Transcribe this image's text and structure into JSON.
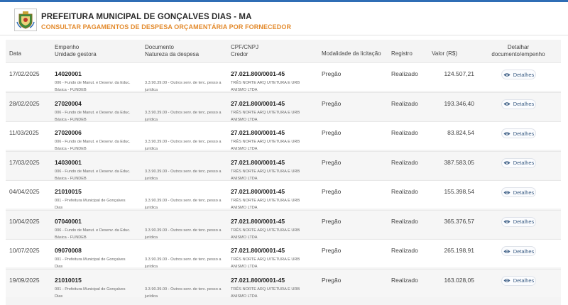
{
  "header": {
    "title": "PREFEITURA MUNICIPAL DE GONÇALVES DIAS  - MA",
    "subtitle": "CONSULTAR PAGAMENTOS DE DESPESA ORÇAMENTÁRIA POR FORNECEDOR"
  },
  "columns": {
    "data": "Data",
    "empenho": "Empenho",
    "unidade": "Unidade gestora",
    "documento": "Documento",
    "natureza": "Natureza da despesa",
    "cpf": "CPF/CNPJ",
    "credor": "Credor",
    "modalidade": "Modalidade da licitação",
    "registro": "Registro",
    "valor": "Valor (R$)",
    "detalhar1": "Detalhar",
    "detalhar2": "documento/empenho"
  },
  "button_label": "Detalhes",
  "rows": [
    {
      "date": "17/02/2025",
      "empenho": "14020001",
      "unidade": "006 - Fundo de Manut. e Desenv. da Educ. Básica - FUNDEB",
      "natureza": "3.3.90.39.00 - Outros serv. de terc. pesso a jurídica",
      "cpf": "27.021.800/0001-45",
      "credor": "TRÊS NORTE ARQ UITETURA E URB ANISMO LTDA",
      "modalidade": "Pregão",
      "registro": "Realizado",
      "valor": "124.507,21"
    },
    {
      "date": "28/02/2025",
      "empenho": "27020004",
      "unidade": "006 - Fundo de Manut. e Desenv. da Educ. Básica - FUNDEB",
      "natureza": "3.3.90.39.00 - Outros serv. de terc. pesso a jurídica",
      "cpf": "27.021.800/0001-45",
      "credor": "TRÊS NORTE ARQ UITETURA E URB ANISMO LTDA",
      "modalidade": "Pregão",
      "registro": "Realizado",
      "valor": "193.346,40"
    },
    {
      "date": "11/03/2025",
      "empenho": "27020006",
      "unidade": "006 - Fundo de Manut. e Desenv. da Educ. Básica - FUNDEB",
      "natureza": "3.3.90.39.00 - Outros serv. de terc. pesso a jurídica",
      "cpf": "27.021.800/0001-45",
      "credor": "TRÊS NORTE ARQ UITETURA E URB ANISMO LTDA",
      "modalidade": "Pregão",
      "registro": "Realizado",
      "valor": "83.824,54"
    },
    {
      "date": "17/03/2025",
      "empenho": "14030001",
      "unidade": "006 - Fundo de Manut. e Desenv. da Educ. Básica - FUNDEB",
      "natureza": "3.3.90.39.00 - Outros serv. de terc. pesso a jurídica",
      "cpf": "27.021.800/0001-45",
      "credor": "TRÊS NORTE ARQ UITETURA E URB ANISMO LTDA",
      "modalidade": "Pregão",
      "registro": "Realizado",
      "valor": "387.583,05"
    },
    {
      "date": "04/04/2025",
      "empenho": "21010015",
      "unidade": "001 - Prefeitura Municipal de Gonçalves Dias",
      "natureza": "3.3.90.39.00 - Outros serv. de terc. pesso a jurídica",
      "cpf": "27.021.800/0001-45",
      "credor": "TRÊS NORTE ARQ UITETURA E URB ANISMO LTDA",
      "modalidade": "Pregão",
      "registro": "Realizado",
      "valor": "155.398,54"
    },
    {
      "date": "10/04/2025",
      "empenho": "07040001",
      "unidade": "006 - Fundo de Manut. e Desenv. da Educ. Básica - FUNDEB",
      "natureza": "3.3.90.39.00 - Outros serv. de terc. pesso a jurídica",
      "cpf": "27.021.800/0001-45",
      "credor": "TRÊS NORTE ARQ UITETURA E URB ANISMO LTDA",
      "modalidade": "Pregão",
      "registro": "Realizado",
      "valor": "365.376,57"
    },
    {
      "date": "10/07/2025",
      "empenho": "09070008",
      "unidade": "001 - Prefeitura Municipal de Gonçalves Dias",
      "natureza": "3.3.90.39.00 - Outros serv. de terc. pesso a jurídica",
      "cpf": "27.021.800/0001-45",
      "credor": "TRÊS NORTE ARQ UITETURA E URB ANISMO LTDA",
      "modalidade": "Pregão",
      "registro": "Realizado",
      "valor": "265.198,91"
    },
    {
      "date": "19/09/2025",
      "empenho": "21010015",
      "unidade": "001 - Prefeitura Municipal de Gonçalves Dias",
      "natureza": "3.3.90.39.00 - Outros serv. de terc. pesso a jurídica",
      "cpf": "27.021.800/0001-45",
      "credor": "TRÊS NORTE ARQ UITETURA E URB ANISMO LTDA",
      "modalidade": "Pregão",
      "registro": "Realizado",
      "valor": "163.028,05"
    }
  ]
}
